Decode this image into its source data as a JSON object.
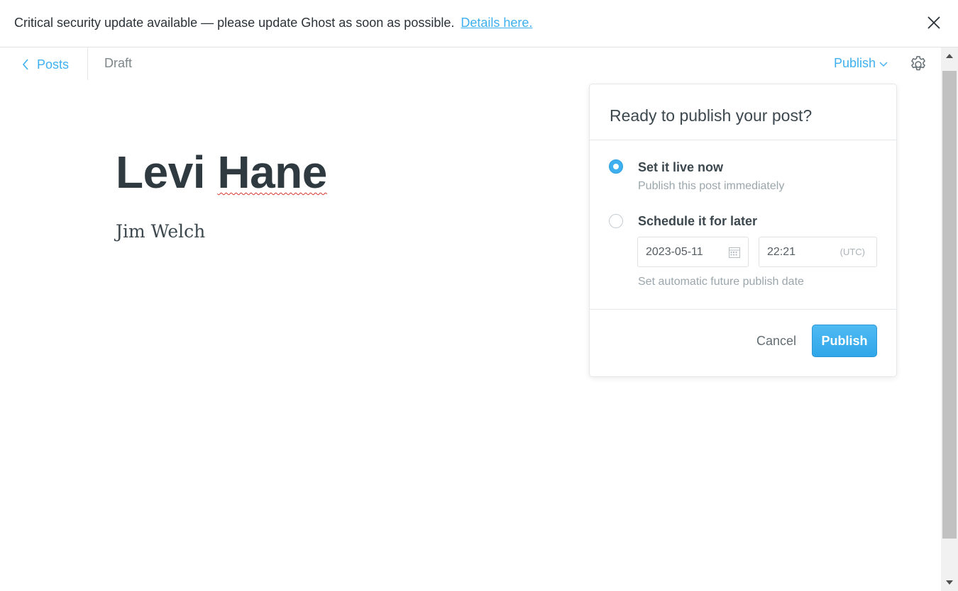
{
  "alert": {
    "message": "Critical security update available — please update Ghost as soon as possible.",
    "link_text": "Details here."
  },
  "header": {
    "back_label": "Posts",
    "status": "Draft",
    "publish_label": "Publish"
  },
  "post": {
    "title_first": "Levi",
    "title_second": "Hane",
    "body": "Jim Welch"
  },
  "publish_menu": {
    "heading": "Ready to publish your post?",
    "options": [
      {
        "title": "Set it live now",
        "description": "Publish this post immediately",
        "selected": true
      },
      {
        "title": "Schedule it for later",
        "description": "Set automatic future publish date",
        "selected": false
      }
    ],
    "date_value": "2023-05-11",
    "time_value": "22:21",
    "timezone": "(UTC)",
    "cancel_label": "Cancel",
    "publish_label": "Publish"
  },
  "colors": {
    "accent": "#3eb0ef",
    "text": "#2e3a40",
    "muted": "#9ba6ac"
  },
  "icons": [
    "close-icon",
    "chevron-left-icon",
    "chevron-down-icon",
    "gear-icon",
    "calendar-icon",
    "scroll-up-icon",
    "scroll-down-icon"
  ]
}
